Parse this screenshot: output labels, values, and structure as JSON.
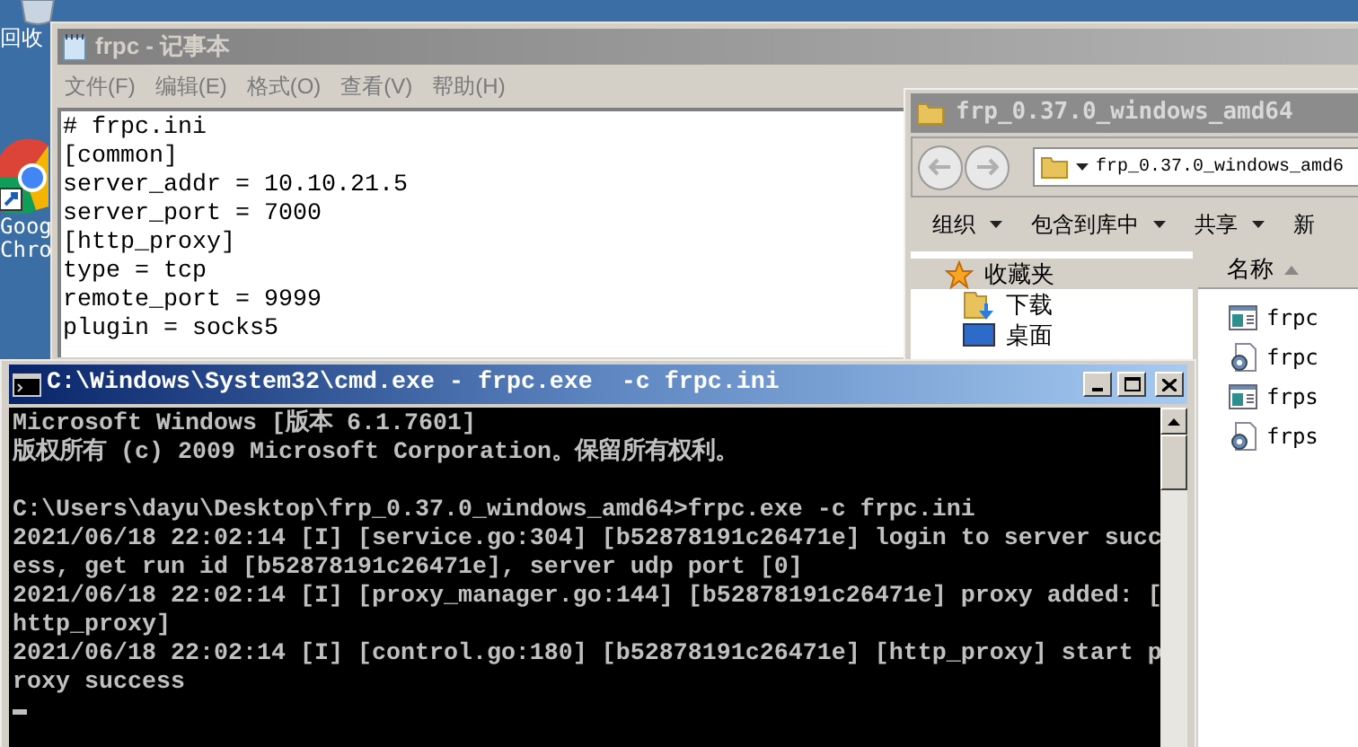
{
  "desktop_icons": [
    {
      "kind": "recycle",
      "lines": [
        "回收"
      ]
    },
    {
      "kind": "browser",
      "lines": [
        "Goog",
        "Chro"
      ]
    }
  ],
  "notepad": {
    "title": "frpc - 记事本",
    "menu": [
      "文件(F)",
      "编辑(E)",
      "格式(O)",
      "查看(V)",
      "帮助(H)"
    ],
    "lines": [
      "# frpc.ini",
      "[common]",
      "server_addr = 10.10.21.5",
      "server_port = 7000",
      "[http_proxy]",
      "type = tcp",
      "remote_port = 9999",
      "plugin = socks5"
    ]
  },
  "explorer": {
    "title": "frp_0.37.0_windows_amd64",
    "address": "frp_0.37.0_windows_amd6",
    "toolbar": [
      {
        "label": "组织",
        "dropdown": true
      },
      {
        "label": "包含到库中",
        "dropdown": true
      },
      {
        "label": "共享",
        "dropdown": true
      },
      {
        "label": "新",
        "dropdown": false
      }
    ],
    "nav": [
      {
        "label": "收藏夹",
        "kind": "favorites",
        "selected": true
      },
      {
        "label": "下载",
        "kind": "downloads",
        "selected": false
      },
      {
        "label": "桌面",
        "kind": "desktop",
        "selected": false
      }
    ],
    "column": "名称",
    "files": [
      {
        "name": "frpc",
        "kind": "app"
      },
      {
        "name": "frpc",
        "kind": "config"
      },
      {
        "name": "frps",
        "kind": "app"
      },
      {
        "name": "frps",
        "kind": "config"
      }
    ]
  },
  "cmd": {
    "title": "C:\\Windows\\System32\\cmd.exe - frpc.exe  -c frpc.ini",
    "blocks": [
      [
        "Microsoft Windows [版本 6.1.7601]",
        "版权所有 (c) 2009 Microsoft Corporation。保留所有权利。"
      ],
      [
        "C:\\Users\\dayu\\Desktop\\frp_0.37.0_windows_amd64>frpc.exe -c frpc.ini",
        "2021/06/18 22:02:14 [I] [service.go:304] [b52878191c26471e] login to server succ",
        "ess, get run id [b52878191c26471e], server udp port [0]",
        "2021/06/18 22:02:14 [I] [proxy_manager.go:144] [b52878191c26471e] proxy added: [",
        "http_proxy]",
        "2021/06/18 22:02:14 [I] [control.go:180] [b52878191c26471e] [http_proxy] start p",
        "roxy success"
      ]
    ]
  }
}
